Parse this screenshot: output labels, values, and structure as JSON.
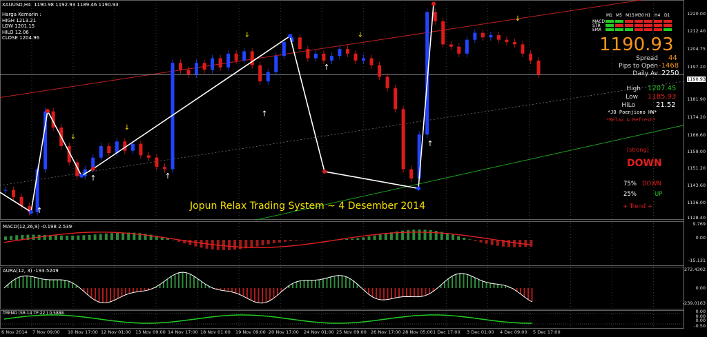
{
  "header": {
    "symbol": "XAUUSD,H4",
    "ohlc": "1190.98 1192.93 1189.46 1190.93"
  },
  "info": {
    "title": "Harga Kemarin :",
    "high": "HIGH 1213.21",
    "low": "LOW 1201.15",
    "hilo": "HILO 12.06",
    "close": "CLOSE 1204.96"
  },
  "watermark": "Jopun Relax Trading System ~ 4 Desember 2014",
  "panel": {
    "timeframes": [
      "M1",
      "M5",
      "M15",
      "M30",
      "H1",
      "H4",
      "D1"
    ],
    "rows": [
      "MACD",
      "STR",
      "EMA"
    ],
    "price": "1190.93",
    "spread_label": "Spread",
    "spread_value": "44",
    "pips_label": "Pips to Open",
    "pips_value": "-1468",
    "daily_label": "Daily Av",
    "daily_value": "2250",
    "high_label": "High",
    "high_value": "1207.45",
    "low_label": "Low",
    "low_value": "1185.93",
    "hilo_label": "HiLo",
    "hilo_value": "21.52",
    "author": "*JO Poenjiono HW*",
    "relax": "*Relax & Refresh*",
    "strength": "[strong]",
    "direction": "DOWN",
    "down_pct": "75%",
    "down_word": "DOWN",
    "up_pct": "25%",
    "up_word": "UP",
    "trend": "+ Trend +",
    "colors": {
      "orange": "#f7941d",
      "red": "#e02020",
      "green": "#22cc22",
      "yellow": "#f5e100"
    }
  },
  "price_axis": [
    "1220.00",
    "1212.40",
    "1204.75",
    "1197.20",
    "1190.93",
    "1181.90",
    "1174.20",
    "1166.60",
    "1159.00",
    "1151.20",
    "1143.60",
    "1136.00",
    "1128.40"
  ],
  "macd": {
    "label": "MACD(12,26,9) -0.198 2.539",
    "axis": [
      "9.769",
      "0.00",
      "-15.131"
    ]
  },
  "aura": {
    "label": "AURA(12, 3) -193.5249",
    "axis": [
      "272.4302",
      "0.00",
      "-239.0163"
    ]
  },
  "trend": {
    "label": "TREND (SR:14 TP:22 ) 0.5888",
    "axis": [
      "0.00",
      "0.00",
      "0.00",
      "-0.50"
    ]
  },
  "x_axis": [
    "6 Nov 2014",
    "7 Nov 09:00",
    "10 Nov 17:00",
    "12 Nov 01:00",
    "13 Nov 09:00",
    "14 Nov 17:00",
    "18 Nov 01:00",
    "19 Nov 09:00",
    "20 Nov 17:00",
    "24 Nov 01:00",
    "25 Nov 09:00",
    "26 Nov 17:00",
    "28 Nov 05:00",
    "1 Dec 17:00",
    "3 Dec 01:00",
    "4 Dec 09:00",
    "5 Dec 17:00"
  ],
  "chart_data": {
    "type": "candlestick",
    "symbol": "XAUUSD",
    "timeframe": "H4",
    "ylim": [
      1128.4,
      1222
    ],
    "zigzag": [
      1131.5,
      1175.2,
      1147.2,
      1150.2,
      1207.6,
      1149.0,
      1141.7,
      1221.5
    ],
    "close_series": [
      1141,
      1138,
      1134,
      1131.5,
      1150,
      1175,
      1168,
      1160,
      1153,
      1147,
      1150,
      1155,
      1160,
      1157,
      1162,
      1158,
      1161,
      1156,
      1155,
      1151,
      1150,
      1196,
      1193,
      1191,
      1196,
      1193,
      1198,
      1194,
      1200,
      1197,
      1201,
      1195,
      1188,
      1192,
      1199,
      1205,
      1207,
      1202,
      1198,
      1200,
      1197,
      1199,
      1202,
      1200,
      1197,
      1198,
      1195,
      1190,
      1185,
      1176,
      1150,
      1146,
      1165,
      1218,
      1214,
      1204,
      1203,
      1200,
      1206,
      1209,
      1207,
      1208,
      1206,
      1205,
      1204,
      1200,
      1197,
      1191
    ]
  }
}
